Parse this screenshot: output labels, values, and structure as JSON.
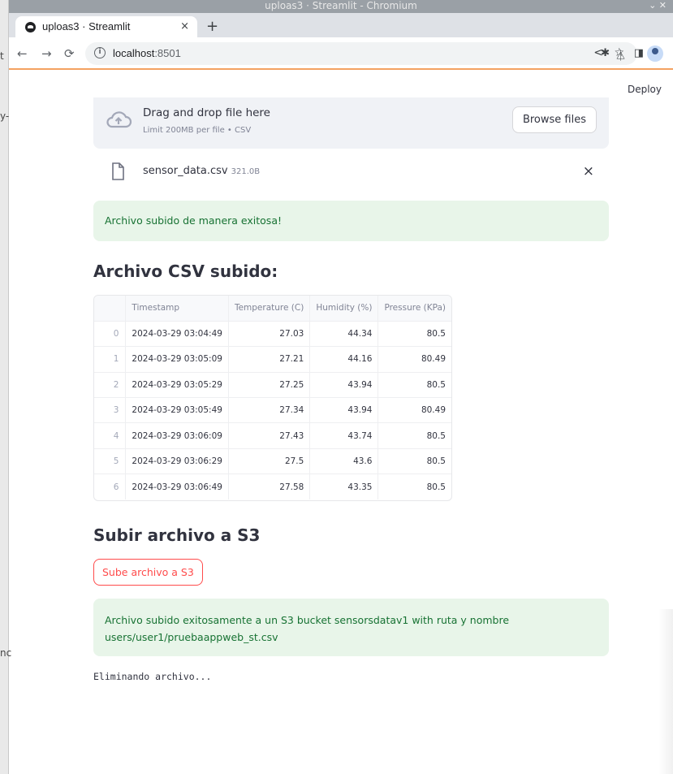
{
  "window": {
    "title": "uploas3 · Streamlit - Chromium"
  },
  "background_window": {
    "fragments": [
      "t",
      "y-",
      "nc"
    ]
  },
  "browser": {
    "tab_title": "uploas3 · Streamlit",
    "tab_close": "×",
    "new_tab": "+",
    "url_host": "localhost",
    "url_port": ":8501",
    "icons": [
      "back-icon",
      "forward-icon",
      "reload-icon",
      "info-icon",
      "share-icon",
      "star-icon",
      "extensions-icon",
      "labs-icon",
      "sidebar-icon",
      "profile-icon"
    ]
  },
  "app": {
    "deploy_label": "Deploy",
    "uploader": {
      "title": "Drag and drop file here",
      "subtitle": "Limit 200MB per file • CSV",
      "browse_label": "Browse files"
    },
    "file": {
      "name": "sensor_data.csv",
      "size": "321.0B",
      "remove": "×"
    },
    "success_upload": "Archivo subido de manera exitosa!",
    "csv_heading": "Archivo CSV subido:",
    "table": {
      "columns": [
        "",
        "Timestamp",
        "Temperature (C)",
        "Humidity (%)",
        "Pressure (KPa)"
      ],
      "rows": [
        [
          "0",
          "2024-03-29 03:04:49",
          "27.03",
          "44.34",
          "80.5"
        ],
        [
          "1",
          "2024-03-29 03:05:09",
          "27.21",
          "44.16",
          "80.49"
        ],
        [
          "2",
          "2024-03-29 03:05:29",
          "27.25",
          "43.94",
          "80.5"
        ],
        [
          "3",
          "2024-03-29 03:05:49",
          "27.34",
          "43.94",
          "80.49"
        ],
        [
          "4",
          "2024-03-29 03:06:09",
          "27.43",
          "43.74",
          "80.5"
        ],
        [
          "5",
          "2024-03-29 03:06:29",
          "27.5",
          "43.6",
          "80.5"
        ],
        [
          "6",
          "2024-03-29 03:06:49",
          "27.58",
          "43.35",
          "80.5"
        ]
      ]
    },
    "s3_heading": "Subir archivo a S3",
    "s3_button": "Sube archivo a S3",
    "success_s3_line1": "Archivo subido exitosamente a un S3 bucket sensorsdatav1 with ruta y nombre",
    "success_s3_line2": "users/user1/pruebaappweb_st.csv",
    "code_output": "Eliminando archivo...",
    "colors": {
      "primary": "#ff4b4b",
      "success_bg": "#e8f5e9",
      "success_text": "#177233"
    }
  }
}
